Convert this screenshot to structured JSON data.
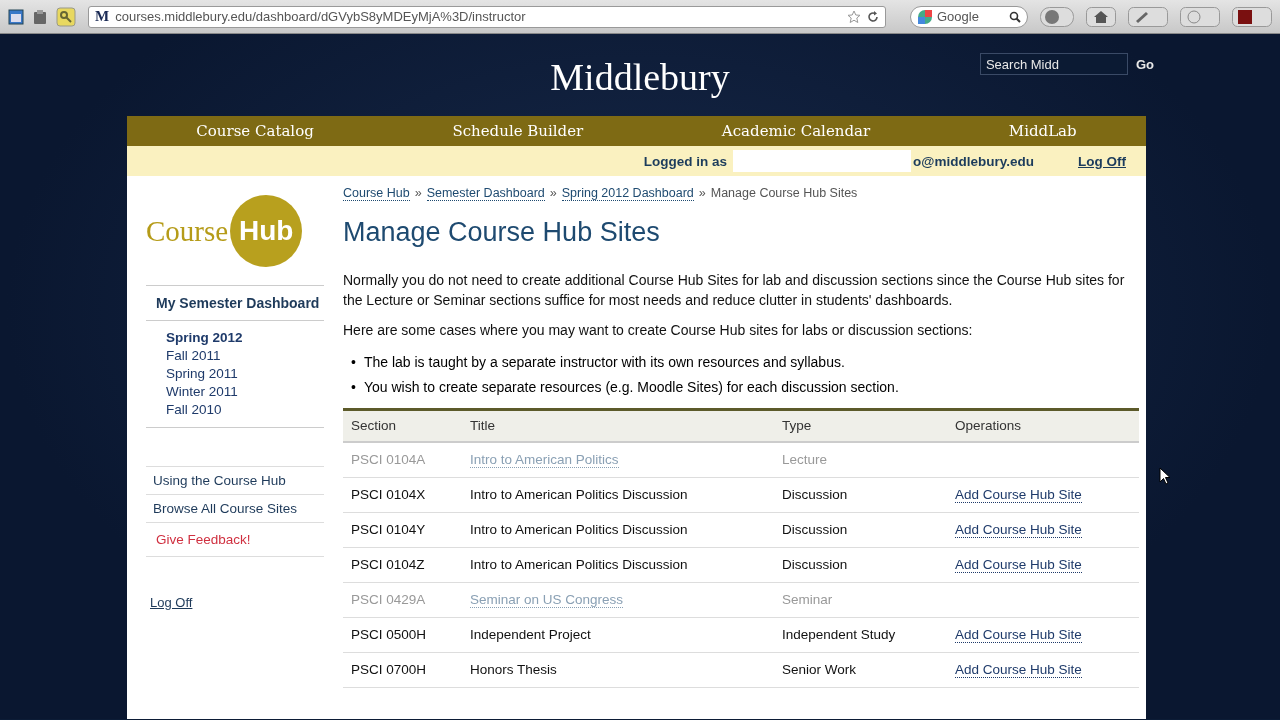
{
  "browser": {
    "url": "courses.middlebury.edu/dashboard/dGVybS8yMDEyMjA%3D/instructor",
    "search_engine": "Google",
    "site_letter": "M"
  },
  "header": {
    "title": "Middlebury",
    "search": {
      "placeholder": "Search Midd"
    },
    "search_button": "Go"
  },
  "nav": [
    "Course Catalog",
    "Schedule Builder",
    "Academic Calendar",
    "MiddLab"
  ],
  "user_bar": {
    "logged_in_label": "Logged in as",
    "email_tail": "o@middlebury.edu",
    "log_off": "Log Off"
  },
  "logo": {
    "word": "Course",
    "badge": "Hub"
  },
  "sidebar": {
    "heading": "My Semester Dashboard",
    "semesters": [
      {
        "label": "Spring 2012",
        "selected": true
      },
      {
        "label": "Fall 2011",
        "selected": false
      },
      {
        "label": "Spring 2011",
        "selected": false
      },
      {
        "label": "Winter 2011",
        "selected": false
      },
      {
        "label": "Fall 2010",
        "selected": false
      }
    ],
    "links": [
      {
        "label": "Using the Course Hub",
        "kind": "normal"
      },
      {
        "label": "Browse All Course Sites",
        "kind": "normal"
      },
      {
        "label": "Give Feedback!",
        "kind": "alert"
      }
    ],
    "log_off": "Log Off"
  },
  "breadcrumbs": [
    {
      "label": "Course Hub",
      "link": true
    },
    {
      "label": "Semester Dashboard",
      "link": true
    },
    {
      "label": "Spring 2012 Dashboard",
      "link": true
    },
    {
      "label": "Manage Course Hub Sites",
      "link": false
    }
  ],
  "breadcrumb_separator": "»",
  "page_title": "Manage Course Hub Sites",
  "intro": "Normally you do not need to create additional Course Hub Sites for lab and discussion sections since the Course Hub sites for the Lecture or Seminar sections suffice for most needs and reduce clutter in students' dashboards.",
  "cases_intro": "Here are some cases where you may want to create Course Hub sites for labs or discussion sections:",
  "bullet": "•",
  "cases": [
    "The lab is taught by a separate instructor with its own resources and syllabus.",
    "You wish to create separate resources (e.g. Moodle Sites) for each discussion section."
  ],
  "table": {
    "columns": [
      "Section",
      "Title",
      "Type",
      "Operations"
    ],
    "rows": [
      {
        "section": "PSCI 0104A",
        "title": "Intro to American Politics",
        "type": "Lecture",
        "disabled": true
      },
      {
        "section": "PSCI 0104X",
        "title": "Intro to American Politics Discussion",
        "type": "Discussion",
        "operation": "Add Course Hub Site",
        "disabled": false
      },
      {
        "section": "PSCI 0104Y",
        "title": "Intro to American Politics Discussion",
        "type": "Discussion",
        "operation": "Add Course Hub Site",
        "disabled": false
      },
      {
        "section": "PSCI 0104Z",
        "title": "Intro to American Politics Discussion",
        "type": "Discussion",
        "operation": "Add Course Hub Site",
        "disabled": false
      },
      {
        "section": "PSCI 0429A",
        "title": "Seminar on US Congress",
        "type": "Seminar",
        "disabled": true
      },
      {
        "section": "PSCI 0500H",
        "title": "Independent Project",
        "type": "Independent Study",
        "operation": "Add Course Hub Site",
        "disabled": false
      },
      {
        "section": "PSCI 0700H",
        "title": "Honors Thesis",
        "type": "Senior Work",
        "operation": "Add Course Hub Site",
        "disabled": false
      }
    ]
  }
}
